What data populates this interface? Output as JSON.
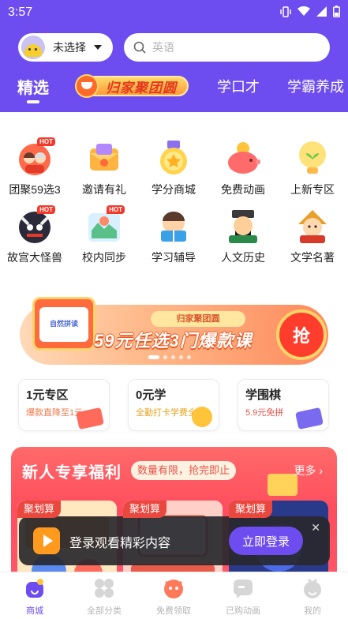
{
  "status_bar": {
    "time": "3:57"
  },
  "header": {
    "grade_label": "未选择",
    "search_placeholder": "英语",
    "tabs": [
      {
        "label": "精选"
      },
      {
        "label": "归家聚团圆"
      },
      {
        "label": "学口才"
      },
      {
        "label": "学霸养成"
      }
    ]
  },
  "grid": [
    {
      "label": "团聚59选3",
      "hot": "HOT"
    },
    {
      "label": "邀请有礼"
    },
    {
      "label": "学分商城"
    },
    {
      "label": "免费动画"
    },
    {
      "label": "上新专区"
    },
    {
      "label": "故宫大怪兽",
      "hot": "HOT"
    },
    {
      "label": "校内同步",
      "hot": "HOT"
    },
    {
      "label": "学习辅导"
    },
    {
      "label": "人文历史"
    },
    {
      "label": "文学名著"
    }
  ],
  "banner": {
    "tag": "归家聚团圆",
    "title": "59元任选3门爆款课",
    "button": "抢",
    "book_label": "自然拼读",
    "page_count": 5,
    "active_page": 1
  },
  "zones": [
    {
      "title": "1元专区",
      "subtitle": "爆款直降至1元"
    },
    {
      "title": "0元学",
      "subtitle": "全勤打卡学费全返"
    },
    {
      "title": "学围棋",
      "subtitle": "5.9元免拼"
    }
  ],
  "newcomer": {
    "title": "新人专享福利",
    "pill": "数量有限，抢完即止",
    "more": "更多",
    "cards": [
      {
        "badge": "聚划算"
      },
      {
        "badge": "聚划算"
      },
      {
        "badge": "聚划算"
      }
    ]
  },
  "toast": {
    "text": "登录观看精彩内容",
    "button": "立即登录",
    "close": "✕"
  },
  "bottom_nav": [
    {
      "label": "商城",
      "active": true
    },
    {
      "label": "全部分类"
    },
    {
      "label": "免费领取"
    },
    {
      "label": "已购动画"
    },
    {
      "label": "我的"
    }
  ],
  "colors": {
    "brand": "#6e4df0",
    "accent_red": "#e9483f",
    "banner_orange": "#ff8a5c"
  }
}
